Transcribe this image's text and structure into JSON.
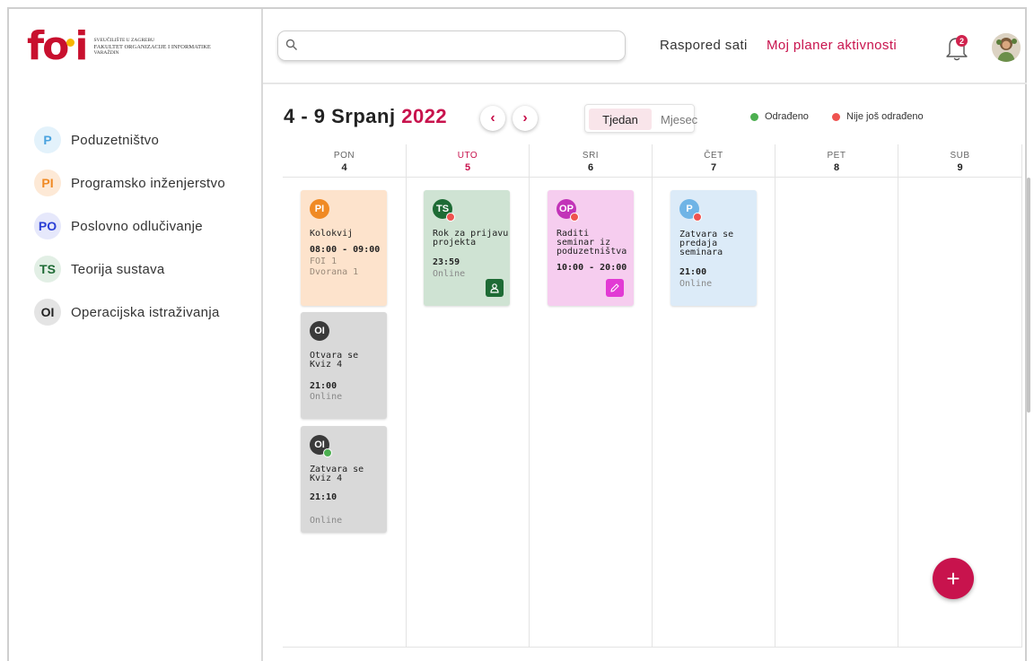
{
  "logo": {
    "mark": "fo",
    "mark_tail": "i",
    "line1": "Sveučilište u Zagrebu",
    "line2": "Fakultet organizacije i informatike",
    "line3": "Varaždin"
  },
  "courses": [
    {
      "code": "P",
      "name": "Poduzetništvo",
      "color": "#4aa3df",
      "bg": "#e3f2fb"
    },
    {
      "code": "PI",
      "name": "Programsko inženjerstvo",
      "color": "#f08a24",
      "bg": "#fde9d6"
    },
    {
      "code": "PO",
      "name": "Poslovno odlučivanje",
      "color": "#2b3fd6",
      "bg": "#e6e8fb"
    },
    {
      "code": "TS",
      "name": "Teorija sustava",
      "color": "#1e6b35",
      "bg": "#e2efe5"
    },
    {
      "code": "OI",
      "name": "Operacijska istraživanja",
      "color": "#222222",
      "bg": "#e4e4e4"
    }
  ],
  "topbar": {
    "search_placeholder": "",
    "nav_schedule": "Raspored sati",
    "nav_planner": "Moj planer aktivnosti",
    "notification_count": "2"
  },
  "week": {
    "range": "4 - 9 Srpanj",
    "year": "2022",
    "view_week": "Tjedan",
    "view_month": "Mjesec",
    "legend_done": "Odrađeno",
    "legend_not_done": "Nije još odrađeno",
    "color_done": "#4caf50",
    "color_not_done": "#ef5350",
    "days": [
      {
        "name": "PON",
        "num": "4"
      },
      {
        "name": "UTO",
        "num": "5"
      },
      {
        "name": "SRI",
        "num": "6"
      },
      {
        "name": "ČET",
        "num": "7"
      },
      {
        "name": "PET",
        "num": "8"
      },
      {
        "name": "SUB",
        "num": "9"
      }
    ]
  },
  "events": {
    "e1": {
      "badge": "PI",
      "title": "Kolokvij",
      "time": "08:00 - 09:00",
      "location": "FOI 1\nDvorana 1"
    },
    "e2": {
      "badge": "OI",
      "title": "Otvara se\nKviz 4",
      "time": "21:00",
      "location": "Online"
    },
    "e3": {
      "badge": "OI",
      "title": "Zatvara se\nKviz 4",
      "time": "21:10",
      "location": "Online"
    },
    "e4": {
      "badge": "TS",
      "title": "Rok za prijavu\nprojekta",
      "time": "23:59",
      "location": "Online"
    },
    "e5": {
      "badge": "OP",
      "title": "Raditi\nseminar iz\npoduzetništva",
      "time": "10:00 - 20:00",
      "location": ""
    },
    "e6": {
      "badge": "P",
      "title": "Zatvara se\npredaja\nseminara",
      "time": "21:00",
      "location": "Online"
    }
  },
  "fab_label": "+"
}
